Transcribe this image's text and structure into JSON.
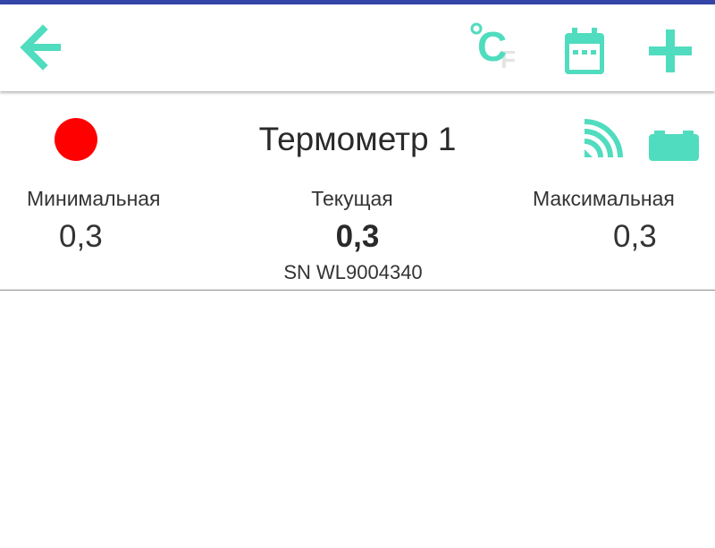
{
  "theme": {
    "accent": "#50dcbe",
    "status_bar": "#3346a8",
    "status_dot": "#ff0000"
  },
  "toolbar": {
    "back_icon": "arrow-left-icon",
    "unit_primary": "C",
    "unit_secondary": "F",
    "unit_degree_icon": "degree-icon",
    "calendar_icon": "calendar-icon",
    "add_icon": "plus-icon"
  },
  "device": {
    "name": "Термометр 1",
    "status_icon": "red-dot-icon",
    "signal_icon": "wifi-signal-icon",
    "battery_icon": "battery-full-icon",
    "serial_prefix": "SN",
    "serial_number": "WL9004340",
    "metrics": {
      "min": {
        "label": "Минимальная",
        "value": "0,3"
      },
      "current": {
        "label": "Текущая",
        "value": "0,3"
      },
      "max": {
        "label": "Максимальная",
        "value": "0,3"
      }
    }
  }
}
